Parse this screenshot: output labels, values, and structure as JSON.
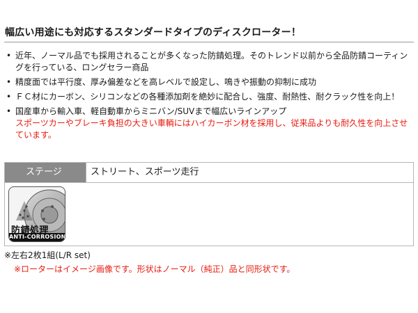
{
  "heading": "幅広い用途にも対応するスタンダードタイプのディスクローター！",
  "bullets": [
    {
      "marker": "•",
      "text": "近年、ノーマル品でも採用されることが多くなった防錆処理。そのトレンド以前から全品防錆コーティングを行っている、ロングセラー商品"
    },
    {
      "marker": "•",
      "text": "精度面では平行度、厚み偏差などを高レベルで設定し、鳴きや振動の抑制に成功"
    },
    {
      "marker": "•",
      "text": "ＦＣ材にカーボン、シリコンなどの各種添加剤を絶妙に配合し、強度、耐熱性、耐クラック性を向上！"
    },
    {
      "marker": "•",
      "text": "国産車から輸入車、軽自動車からミニバン/SUVまで幅広いラインアップ",
      "red": "スポーツカーやブレーキ負担の大きい車輌にはハイカーボン材を採用し、従来品よりも耐久性を向上させています。"
    }
  ],
  "spec": {
    "label": "ステージ",
    "value": "ストリート、スポーツ走行"
  },
  "badge": {
    "text": "防錆処理",
    "sub": "ANTI-CORROSION",
    "icon": "disc-rotor-icon"
  },
  "notes": {
    "set": "※左右2枚1組(L/R set)",
    "image": "※ローターはイメージ画像です。形状はノーマル（純正）品と同形状です。"
  },
  "colors": {
    "accent_red": "#e8190c",
    "label_bg": "#8a8a8a"
  }
}
